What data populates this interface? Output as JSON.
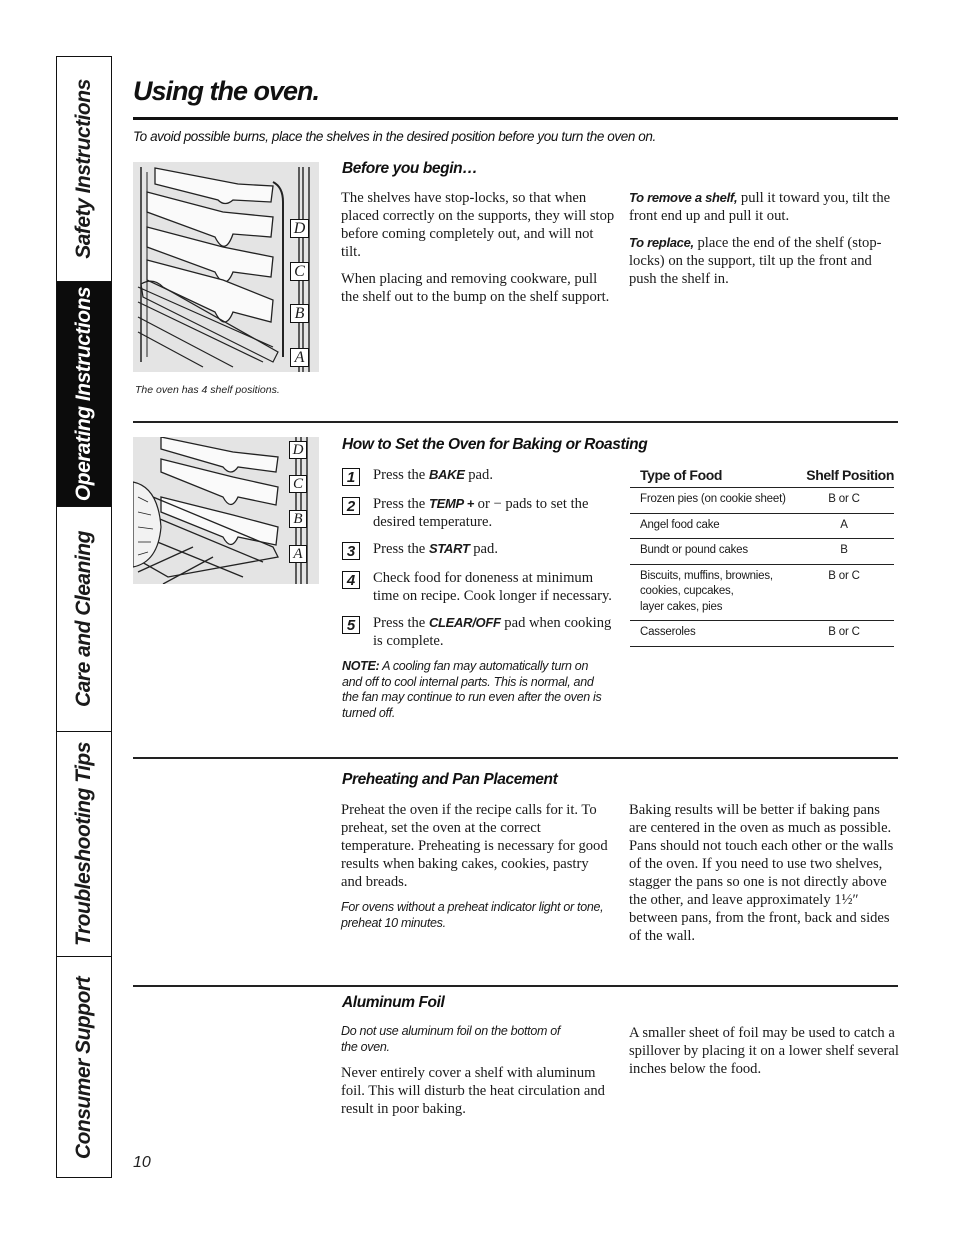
{
  "side_tabs": [
    {
      "label": "Safety Instructions",
      "active": false
    },
    {
      "label": "Operating Instructions",
      "active": true
    },
    {
      "label": "Care and Cleaning",
      "active": false
    },
    {
      "label": "Troubleshooting Tips",
      "active": false
    },
    {
      "label": "Consumer Support",
      "active": false
    }
  ],
  "header": {
    "title": "Using the oven.",
    "intro": "To avoid possible burns, place the shelves in the desired position before you turn the oven on."
  },
  "before_you_begin": {
    "heading": "Before you begin…",
    "illustration": {
      "icon": "oven-shelf-positions-illustration",
      "shelf_labels": [
        "D",
        "C",
        "B",
        "A"
      ],
      "caption": "The oven has 4 shelf positions."
    },
    "paragraphs": [
      "The shelves have stop-locks, so that when placed correctly on the supports, they will stop before coming completely out, and will not tilt.",
      "When placing and removing cookware, pull the shelf out to the bump on the shelf support."
    ],
    "remove": {
      "lead": "To remove a shelf,",
      "text": " pull it toward you, tilt the front end up and pull it out."
    },
    "replace": {
      "lead": "To replace,",
      "text": " place the end of the shelf (stop-locks) on the support, tilt up the front and push the shelf in."
    }
  },
  "baking": {
    "heading": "How to Set the Oven for Baking or Roasting",
    "illustration": {
      "icon": "oven-baking-pan-illustration",
      "shelf_labels": [
        "D",
        "C",
        "B",
        "A"
      ]
    },
    "steps": [
      {
        "num": "1",
        "pre": "Press the ",
        "key": "BAKE",
        "post": " pad."
      },
      {
        "num": "2",
        "pre": "Press the ",
        "key": "TEMP +",
        "post": " or − pads to set the desired temperature."
      },
      {
        "num": "3",
        "pre": "Press the ",
        "key": "START",
        "post": " pad."
      },
      {
        "num": "4",
        "pre": "Check food for doneness at minimum time on recipe. Cook longer if necessary.",
        "key": "",
        "post": ""
      },
      {
        "num": "5",
        "pre": "Press the ",
        "key": "CLEAR/OFF",
        "post": " pad when cooking is complete."
      }
    ],
    "note_label": "NOTE:",
    "note_text": " A cooling fan may automatically turn on and off to cool internal parts. This is normal, and the fan may continue to run even after the oven is turned off.",
    "table": {
      "headers": [
        "Type of Food",
        "Shelf Position"
      ],
      "rows": [
        {
          "food": "Frozen pies (on cookie sheet)",
          "position": "B or C"
        },
        {
          "food": "Angel food cake",
          "position": "A"
        },
        {
          "food": "Bundt or pound cakes",
          "position": "B"
        },
        {
          "food": "Biscuits, muffins, brownies,\ncookies, cupcakes,\nlayer cakes, pies",
          "position": "B or C"
        },
        {
          "food": "Casseroles",
          "position": "B or C"
        }
      ]
    }
  },
  "preheating": {
    "heading": "Preheating and Pan Placement",
    "left_paragraph": "Preheat the oven if the recipe calls for it. To preheat, set the oven at the correct temperature. Preheating is necessary for good results when baking cakes, cookies, pastry and breads.",
    "left_note": "For ovens without a preheat indicator light or tone, preheat 10 minutes.",
    "right_paragraph": "Baking results will be better if baking pans are centered in the oven as much as possible. Pans should not touch each other or the walls of the oven. If you need to use two shelves, stagger the pans so one is not directly above the other, and leave approximately 1½″ between pans, from the front, back and sides of the wall."
  },
  "aluminum_foil": {
    "heading": "Aluminum Foil",
    "left_note": "Do not use aluminum foil on the bottom of the oven.",
    "left_paragraph": "Never entirely cover a shelf with aluminum foil. This will disturb the heat circulation and result in poor baking.",
    "right_paragraph": "A smaller sheet of foil may be used to catch a spillover by placing it on a lower shelf several inches below the food."
  },
  "footer": {
    "page_number": "10"
  }
}
